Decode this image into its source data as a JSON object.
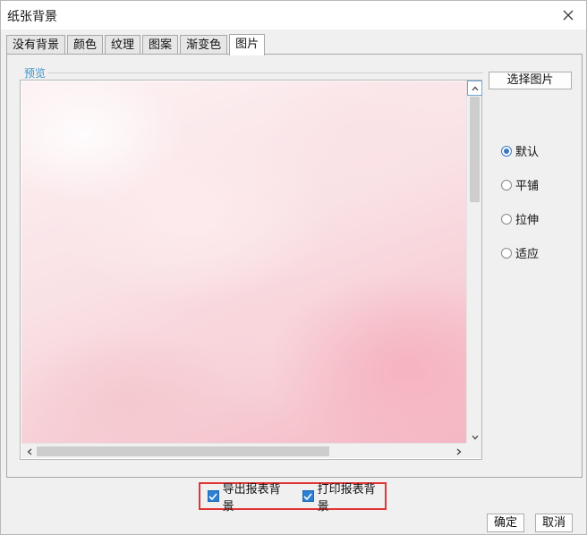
{
  "window": {
    "title": "纸张背景"
  },
  "tabs": [
    {
      "label": "没有背景",
      "active": false
    },
    {
      "label": "颜色",
      "active": false
    },
    {
      "label": "纹理",
      "active": false
    },
    {
      "label": "图案",
      "active": false
    },
    {
      "label": "渐变色",
      "active": false
    },
    {
      "label": "图片",
      "active": true
    }
  ],
  "preview": {
    "legend": "预览"
  },
  "choose_button": {
    "label": "选择图片"
  },
  "layout_options": [
    {
      "label": "默认",
      "checked": true
    },
    {
      "label": "平铺",
      "checked": false
    },
    {
      "label": "拉伸",
      "checked": false
    },
    {
      "label": "适应",
      "checked": false
    }
  ],
  "export_options": [
    {
      "label": "导出报表背景",
      "checked": true
    },
    {
      "label": "打印报表背景",
      "checked": true
    }
  ],
  "footer": {
    "ok_label": "确定",
    "cancel_label": "取消"
  },
  "colors": {
    "accent": "#2d7fd3",
    "highlight_border": "#e03535",
    "legend": "#3b93c9"
  }
}
